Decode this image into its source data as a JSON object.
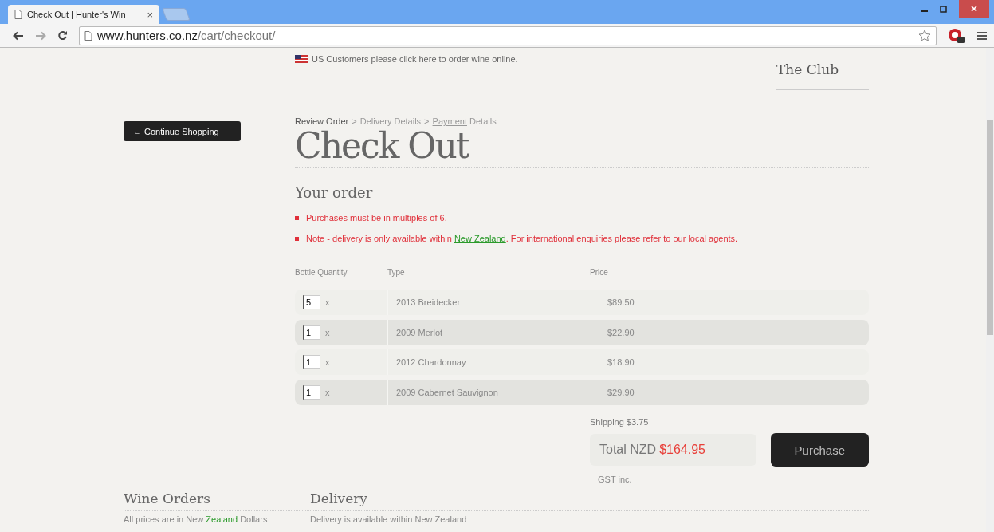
{
  "browser": {
    "tab_title": "Check Out | Hunter's Win",
    "tab_close": "×",
    "address_host": "www.hunters.co.nz",
    "address_path": "/cart/checkout/"
  },
  "notice": {
    "text": "US Customers please click here to order wine online."
  },
  "club_link": "The Club",
  "continue_button": "← Continue Shopping",
  "breadcrumb": [
    {
      "text": "Review Order",
      "selected": true
    },
    {
      "separator": ">",
      "text": "Delivery Details",
      "selected": false
    },
    {
      "separator": ">",
      "link": "Payment",
      "text": "Details",
      "selected": false
    }
  ],
  "title": "Check Out",
  "order": {
    "heading": "Your order",
    "notes": [
      {
        "parts": [
          {
            "text": "Purchases must be in multiples of 6.",
            "kind": "text"
          }
        ]
      },
      {
        "parts": [
          {
            "text": "Note - delivery is only available within",
            "kind": "text"
          },
          {
            "text": "New Zealand",
            "kind": "link"
          },
          {
            "text": ". For international enquiries please refer to our local agents.",
            "kind": "text"
          }
        ]
      }
    ],
    "columns": [
      "Bottle Quantity",
      "Type",
      "Price"
    ],
    "rows": [
      {
        "quantity": "5",
        "x": "x",
        "type": "2013 Breidecker",
        "price": "$89.50"
      },
      {
        "quantity": "1",
        "x": "x",
        "type": "2009 Merlot",
        "price": "$22.90"
      },
      {
        "quantity": "1",
        "x": "x",
        "type": "2012 Chardonnay",
        "price": "$18.90"
      },
      {
        "quantity": "1",
        "x": "x",
        "type": "2009 Cabernet Sauvignon",
        "price": "$29.90"
      }
    ],
    "shipping": "Shipping $3.75",
    "total_label": "Total NZD",
    "total_value": "$164.95",
    "tax_note": "GST inc.",
    "purchase_button": "Purchase"
  },
  "footer": [
    {
      "heading": "Wine Orders",
      "parts": [
        {
          "text": "All prices are in New",
          "kind": "text"
        },
        {
          "text": "Zealand",
          "kind": "link"
        },
        {
          "text": "Dollars",
          "kind": "text"
        }
      ]
    },
    {
      "heading": "Delivery",
      "parts": [
        {
          "text": "Delivery is available within New Zealand",
          "kind": "text"
        }
      ]
    }
  ]
}
